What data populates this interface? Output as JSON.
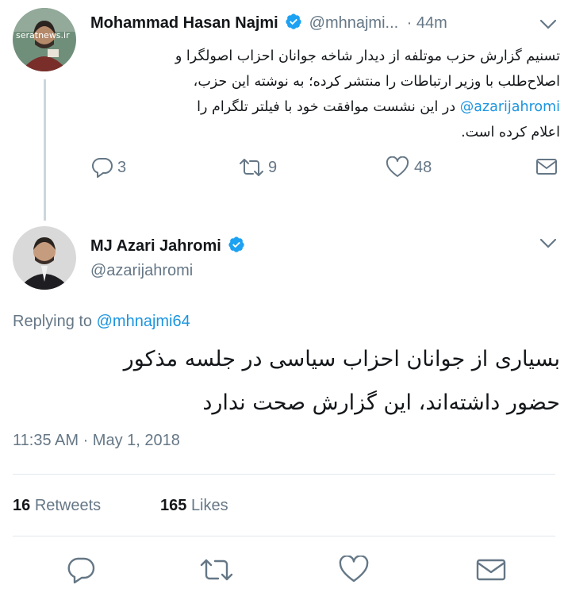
{
  "tweet1": {
    "author_name": "Mohammad Hasan Najmi",
    "author_handle": "@mhnajmi...",
    "time": "· 44m",
    "avatar_watermark": "seratnews.ir",
    "text_line1": "تسنیم گزارش حزب موتلفه از دیدار شاخه جوانان احزاب اصولگرا و",
    "text_line2": "اصلاح‌طلب با وزیر ارتباطات را منتشر کرده؛ به نوشته این حزب،",
    "text_line3_mention": "@azarijahromi",
    "text_line3_rest": "در این نشست موافقت خود با فیلتر تلگرام را",
    "text_line4": "اعلام کرده است.",
    "reply_count": "3",
    "retweet_count": "9",
    "like_count": "48"
  },
  "tweet2": {
    "author_name": "MJ Azari Jahromi",
    "author_handle": "@azarijahromi",
    "replying_prefix": "Replying to",
    "replying_to": "@mhnajmi64",
    "text_line1": "بسیاری از جوانان احزاب سیاسی در جلسه مذکور",
    "text_line2": "حضور داشته‌اند، این گزارش صحت ندارد",
    "timestamp": "11:35 AM · May 1, 2018",
    "retweets_count": "16",
    "retweets_label": "Retweets",
    "likes_count": "165",
    "likes_label": "Likes"
  },
  "colors": {
    "link": "#1b95e0",
    "muted": "#657786",
    "divider": "#e1e8ed",
    "verified": "#1da1f2"
  },
  "icons": [
    "chevron-down-icon",
    "verified-badge-icon",
    "reply-icon",
    "retweet-icon",
    "like-icon",
    "dm-icon"
  ]
}
